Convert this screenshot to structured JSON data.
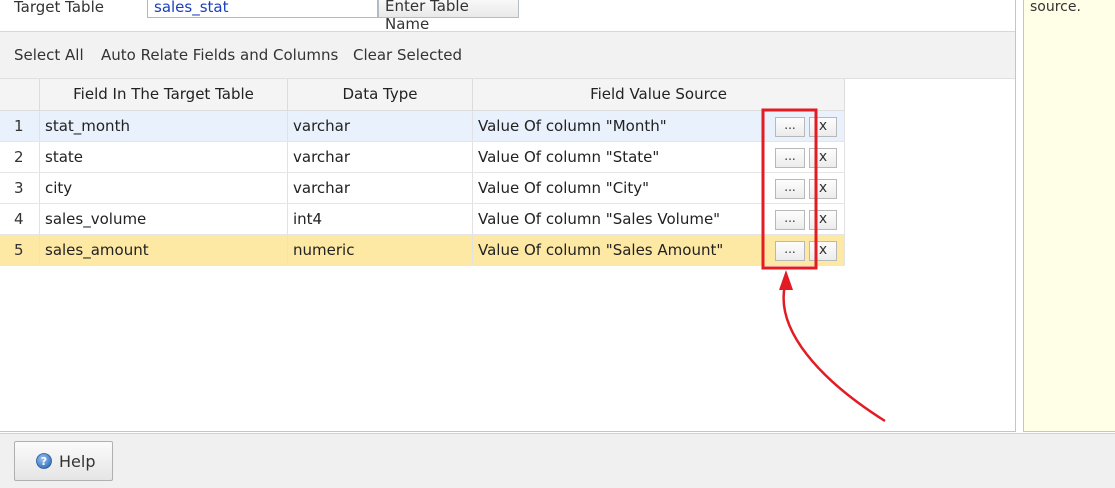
{
  "target": {
    "label": "Target Table",
    "value": "sales_stat",
    "button_label": "Enter Table Name"
  },
  "toolbar": {
    "select_all": "Select All",
    "auto_relate": "Auto Relate Fields and Columns",
    "clear_selected": "Clear Selected"
  },
  "grid": {
    "columns": [
      "Field In The Target Table",
      "Data Type",
      "Field Value Source"
    ],
    "rows": [
      {
        "num": "1",
        "field": "stat_month",
        "type": "varchar",
        "source": "Value Of column \"Month\""
      },
      {
        "num": "2",
        "field": "state",
        "type": "varchar",
        "source": "Value Of column \"State\""
      },
      {
        "num": "3",
        "field": "city",
        "type": "varchar",
        "source": "Value Of column \"City\""
      },
      {
        "num": "4",
        "field": "sales_volume",
        "type": "int4",
        "source": "Value Of column \"Sales Volume\""
      },
      {
        "num": "5",
        "field": "sales_amount",
        "type": "numeric",
        "source": "Value Of column \"Sales Amount\""
      }
    ],
    "more_label": "...",
    "remove_label": "x"
  },
  "right_panel": {
    "hint": "source."
  },
  "footer": {
    "help_label": "Help",
    "help_icon": "help-circle-icon"
  },
  "colors": {
    "selected_row": "#e9f1fc",
    "highlight_row": "#fde8a4",
    "annotation": "#e31b23",
    "hint_panel": "#fffee6"
  }
}
